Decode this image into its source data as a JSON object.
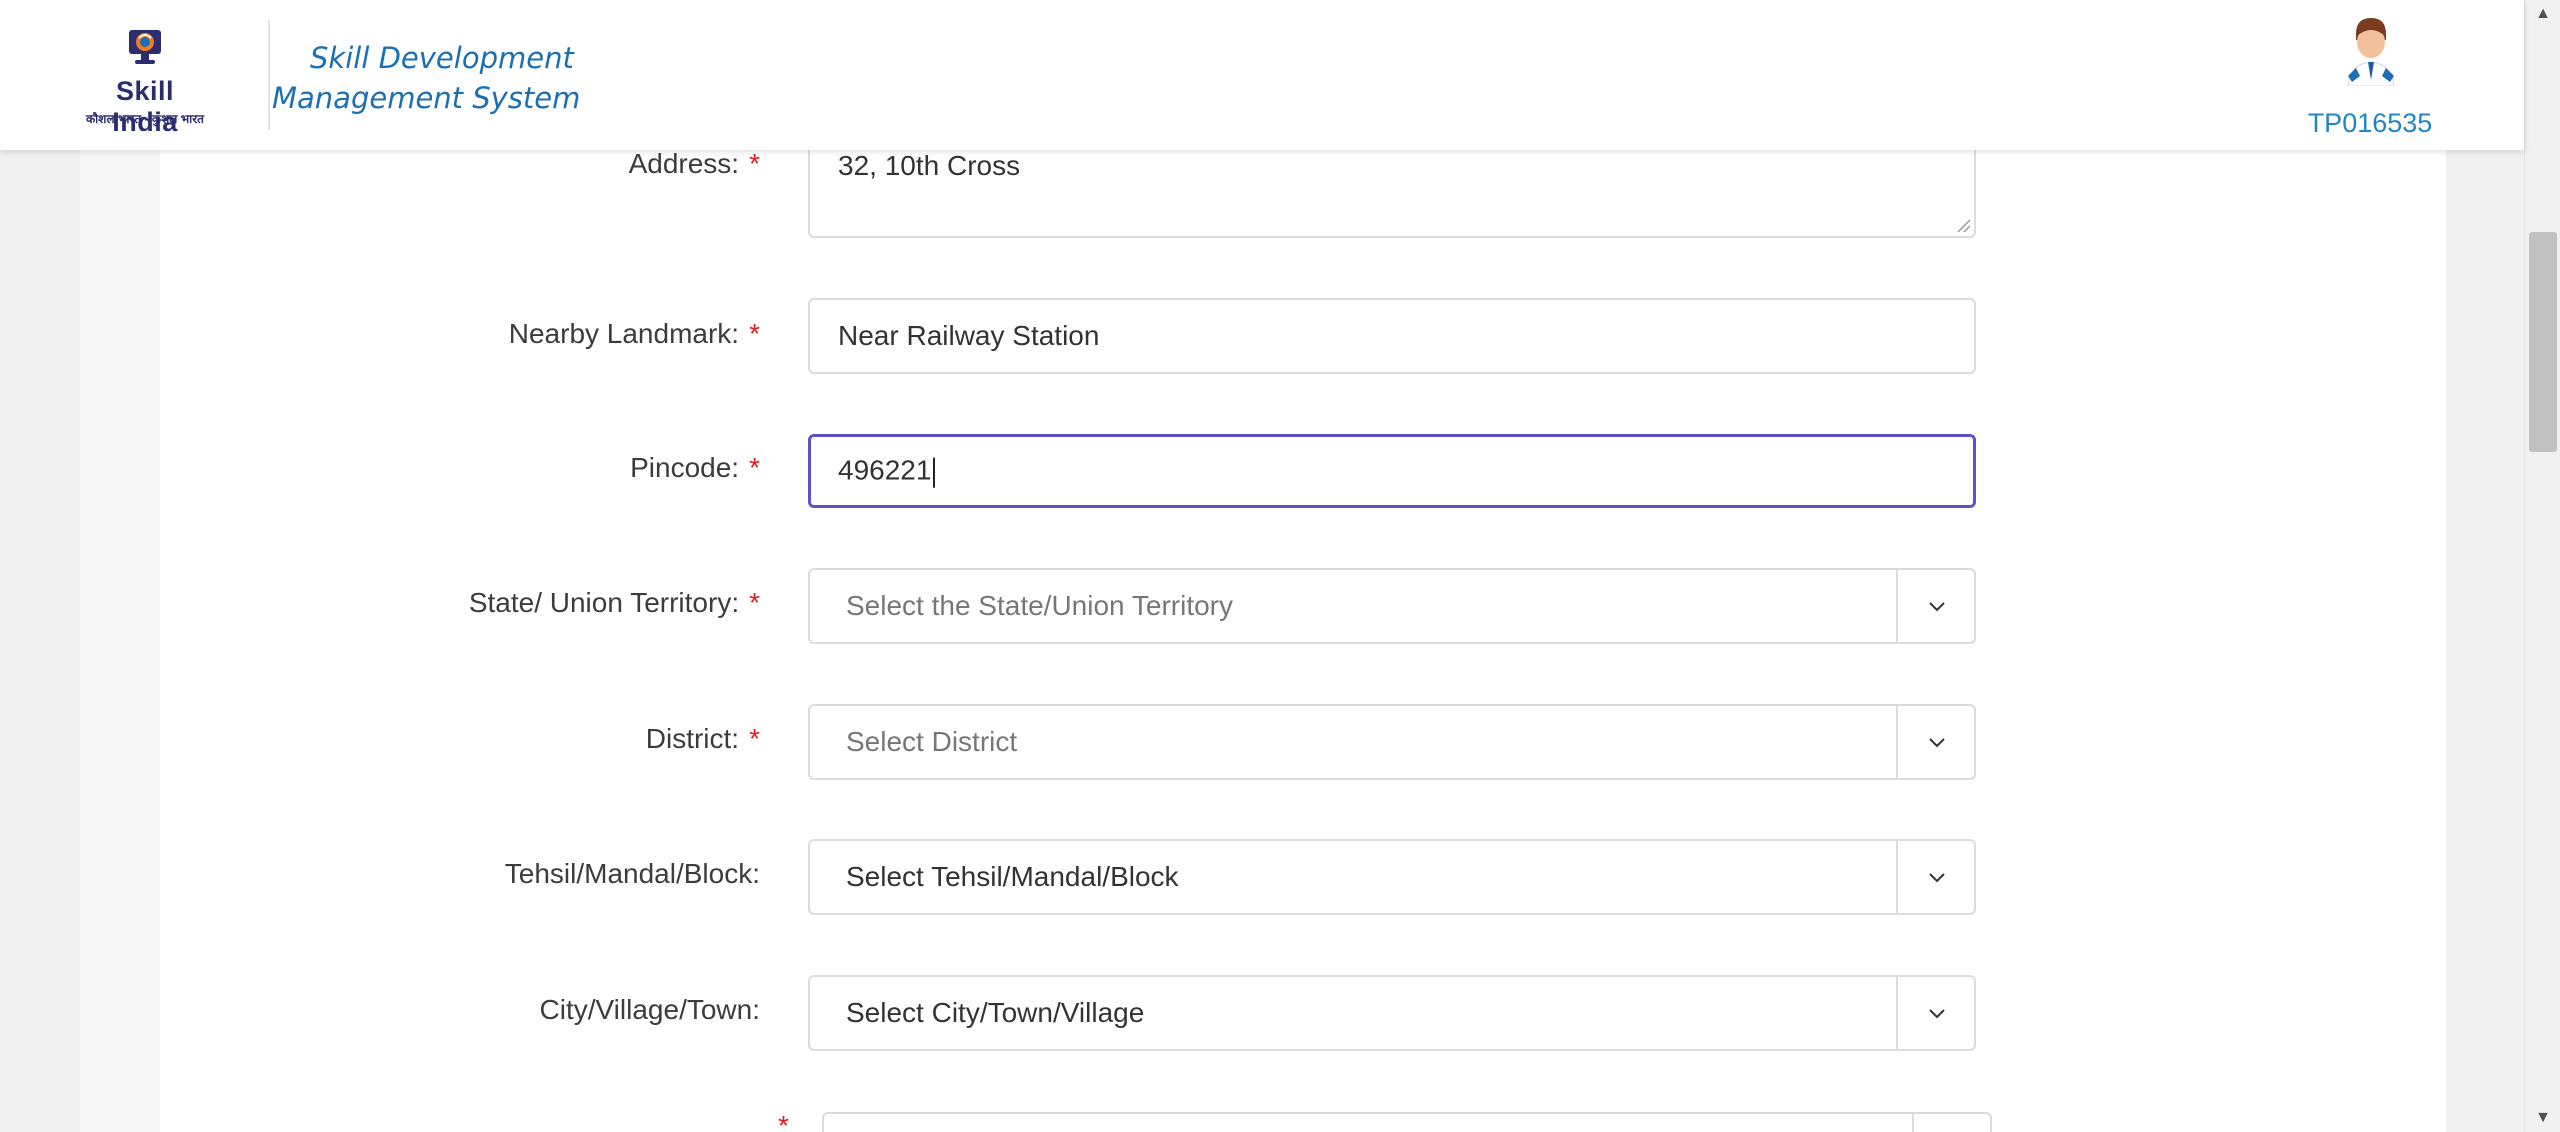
{
  "header": {
    "logo_wordmark": "Skill India",
    "logo_tagline": "कौशल भारत - कुशल भारत",
    "system_title": "Skill Development Management System",
    "user_id": "TP016535"
  },
  "form": {
    "address": {
      "label": "Address:",
      "required_mark": "*",
      "value": "32, 10th Cross"
    },
    "landmark": {
      "label": "Nearby Landmark:",
      "required_mark": "*",
      "value": "Near Railway Station"
    },
    "pincode": {
      "label": "Pincode:",
      "required_mark": "*",
      "value": "496221"
    },
    "state": {
      "label": "State/ Union Territory:",
      "required_mark": "*",
      "placeholder": "Select the State/Union Territory"
    },
    "district": {
      "label": "District:",
      "required_mark": "*",
      "placeholder": "Select District"
    },
    "tehsil": {
      "label": "Tehsil/Mandal/Block:",
      "selected": "Select Tehsil/Mandal/Block"
    },
    "city": {
      "label": "City/Village/Town:",
      "selected": "Select City/Town/Village"
    },
    "next_required_mark": "*"
  },
  "colors": {
    "title_blue": "#1c6fb4",
    "user_id_blue": "#1f86c8",
    "required_red": "#e11d1d",
    "focus_border": "#5b52c7"
  },
  "icons": {
    "dropdown": "chevron-down-icon",
    "avatar": "user-avatar-icon"
  }
}
